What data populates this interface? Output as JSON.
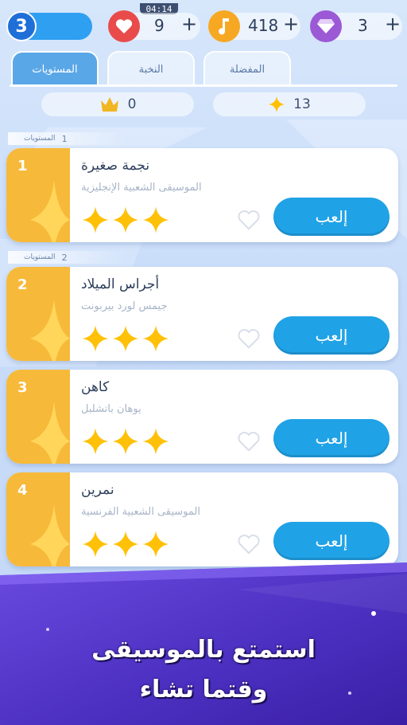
{
  "top_bar": {
    "level": "3",
    "timer": "04:14",
    "lives": "9",
    "notes": "418",
    "gems": "3",
    "plus": "+"
  },
  "tabs": [
    {
      "label": "المفضلة"
    },
    {
      "label": "النخبة"
    },
    {
      "label": "المستويات"
    }
  ],
  "stats": {
    "stars": "13",
    "crowns": "0"
  },
  "sections": [
    {
      "label": "المستويات",
      "number": "1"
    },
    {
      "label": "المستويات",
      "number": "2"
    }
  ],
  "songs": [
    {
      "number": "1",
      "title": "نجمة صغيرة",
      "subtitle": "الموسيقى الشعبية الإنجليزية",
      "stars": 3,
      "play_label": "إلعب"
    },
    {
      "number": "2",
      "title": "أجراس الميلاد",
      "subtitle": "جيمس لورد بيربونت",
      "stars": 3,
      "play_label": "إلعب"
    },
    {
      "number": "3",
      "title": "كاهن",
      "subtitle": "يوهان باتشلبل",
      "stars": 3,
      "play_label": "إلعب"
    },
    {
      "number": "4",
      "title": "نمرين",
      "subtitle": "الموسيقى الشعبية الفرنسية",
      "stars": 3,
      "play_label": "إلعب"
    }
  ],
  "banner": {
    "line1": "استمتع بالموسيقى",
    "line2": "وقتما تشاء"
  },
  "colors": {
    "accent_blue": "#20a2e6",
    "card_side": "#f7b93a",
    "star": "#ffc107",
    "heart_red": "#e94b4b",
    "note_orange": "#f7a823",
    "gem_purple": "#9b59d6",
    "banner": "#5a3fd0"
  }
}
